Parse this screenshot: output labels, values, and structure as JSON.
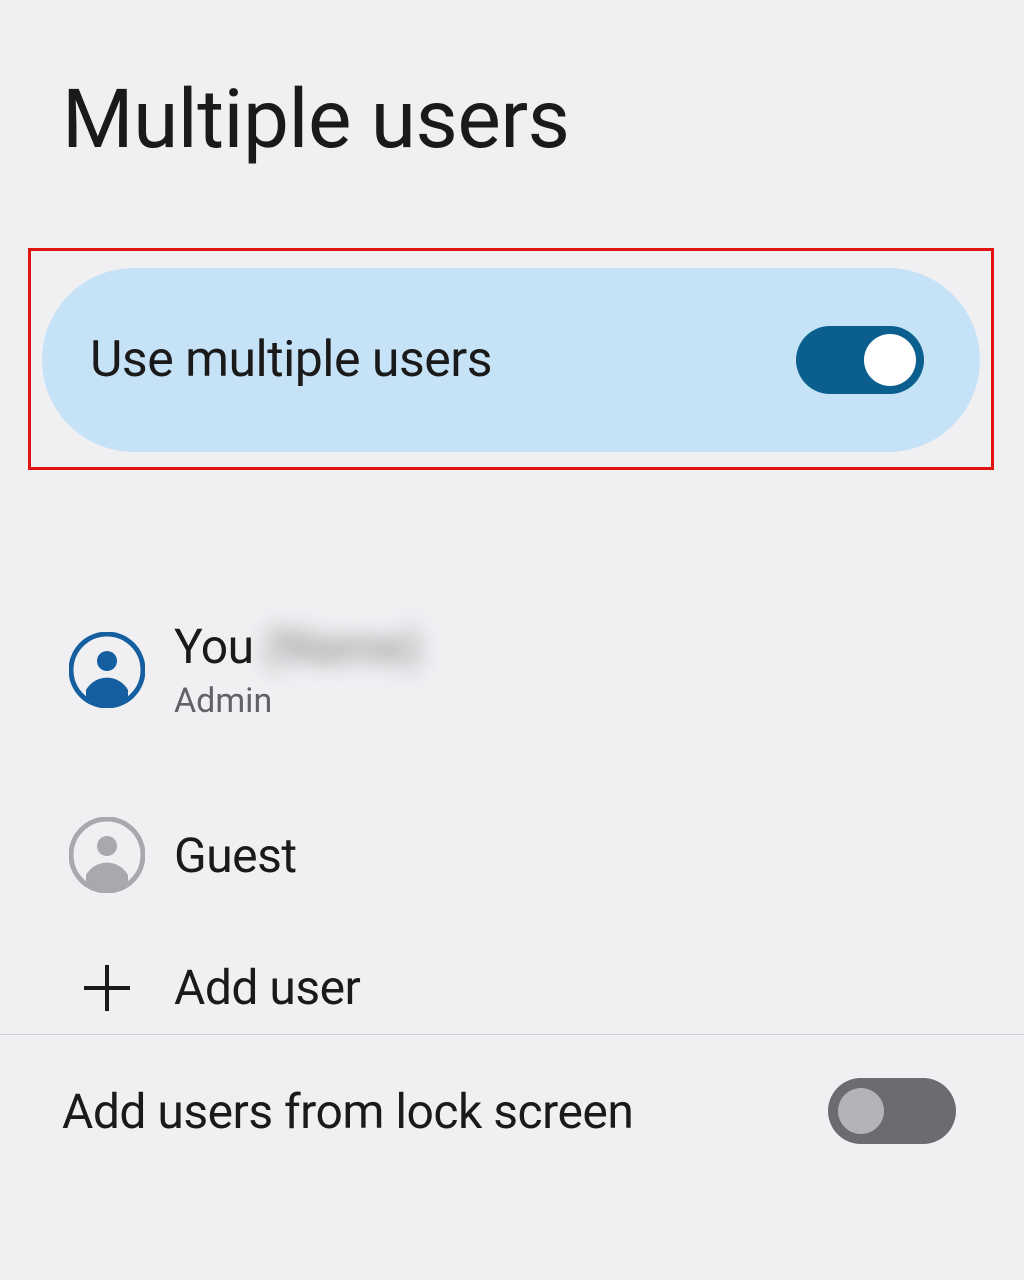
{
  "header": {
    "title": "Multiple users"
  },
  "toggle": {
    "label": "Use multiple users",
    "state": "on"
  },
  "users": [
    {
      "id": "you",
      "name_prefix": "You",
      "name_blurred": "(Name)",
      "role": "Admin"
    },
    {
      "id": "guest",
      "label": "Guest"
    }
  ],
  "add_user": {
    "label": "Add user"
  },
  "lock_screen": {
    "label": "Add users from lock screen",
    "state": "off"
  },
  "colors": {
    "toggle_card_bg": "#c6e2f7",
    "switch_on_track": "#0b5f8f",
    "switch_off_track": "#6b6b70",
    "avatar_active": "#155fa0",
    "avatar_inactive": "#a8a8ad",
    "highlight_border": "#e11313"
  }
}
